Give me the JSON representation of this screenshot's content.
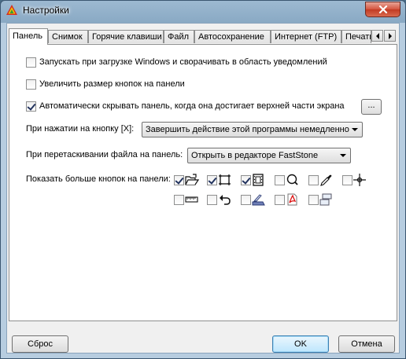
{
  "window": {
    "title": "Настройки"
  },
  "tabs": [
    {
      "label": "Панель",
      "active": true
    },
    {
      "label": "Снимок"
    },
    {
      "label": "Горячие клавиши"
    },
    {
      "label": "Файл"
    },
    {
      "label": "Автосохранение"
    },
    {
      "label": "Интернет (FTP)"
    },
    {
      "label": "Печать"
    }
  ],
  "options": {
    "startup": {
      "label": "Запускать при загрузке Windows и сворачивать в область уведомлений",
      "checked": false
    },
    "bigger_buttons": {
      "label": "Увеличить размер кнопок на панели",
      "checked": false
    },
    "autohide": {
      "label": "Автоматически скрывать панель, когда она достигает верхней части экрана",
      "checked": true,
      "more_label": "..."
    }
  },
  "on_close": {
    "label": "При нажатии на кнопку [X]:",
    "value": "Завершить действие этой программы немедленно"
  },
  "on_drop": {
    "label": "При перетаскивании файла на панель:",
    "value": "Открыть в редакторе FastStone"
  },
  "more_buttons": {
    "label": "Показать больше кнопок на панели:",
    "row1": [
      {
        "icon": "open-folder-icon",
        "checked": true
      },
      {
        "icon": "capture-rectangle-icon",
        "checked": true
      },
      {
        "icon": "filmstrip-icon",
        "checked": true
      },
      {
        "icon": "magnifier-icon",
        "checked": false
      },
      {
        "icon": "color-picker-icon",
        "checked": false
      },
      {
        "icon": "crosshair-icon",
        "checked": false
      }
    ],
    "row2": [
      {
        "icon": "ruler-icon",
        "checked": false
      },
      {
        "icon": "undo-icon",
        "checked": false
      },
      {
        "icon": "scanner-icon",
        "checked": false
      },
      {
        "icon": "pdf-icon",
        "checked": false
      },
      {
        "icon": "window-stack-icon",
        "checked": false
      }
    ]
  },
  "footer": {
    "reset_label": "Сброс",
    "ok_label": "OK",
    "cancel_label": "Отмена"
  },
  "colors": {
    "titlebar": "#9db9d1",
    "close": "#c23a22",
    "default_button": "#bee6fd"
  }
}
